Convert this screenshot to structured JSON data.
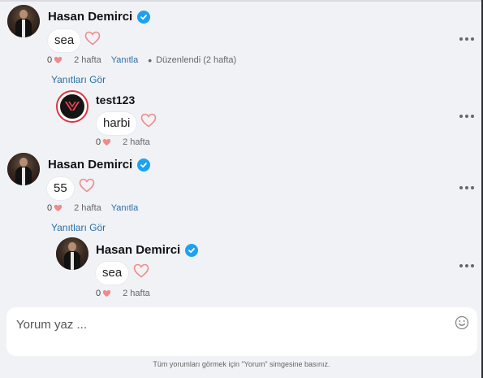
{
  "comments": [
    {
      "author": "Hasan Demirci",
      "verified": true,
      "text": "sea",
      "likes": "0",
      "time": "2 hafta",
      "reply_label": "Yanıtla",
      "edited": "Düzenlendi (2 hafta)",
      "see_replies": "Yanıtları Gör",
      "replies": [
        {
          "author": "test123",
          "verified": false,
          "text": "harbi",
          "likes": "0",
          "time": "2 hafta"
        }
      ]
    },
    {
      "author": "Hasan Demirci",
      "verified": true,
      "text": "55",
      "likes": "0",
      "time": "2 hafta",
      "reply_label": "Yanıtla",
      "see_replies": "Yanıtları Gör",
      "replies": [
        {
          "author": "Hasan Demirci",
          "verified": true,
          "text": "sea",
          "likes": "0",
          "time": "2 hafta"
        }
      ]
    }
  ],
  "composer": {
    "placeholder": "Yorum yaz ...",
    "hint": "Tüm yorumları görmek için \"Yorum\" simgesine basınız."
  },
  "colors": {
    "verified": "#1da1f2",
    "heart": "#f08a8a",
    "link": "#2d6ea2",
    "avatar_ring": "#e0343e"
  },
  "icons": [
    "verified-badge-icon",
    "heart-outline-icon",
    "heart-filled-icon",
    "more-options-icon",
    "emoji-icon"
  ]
}
